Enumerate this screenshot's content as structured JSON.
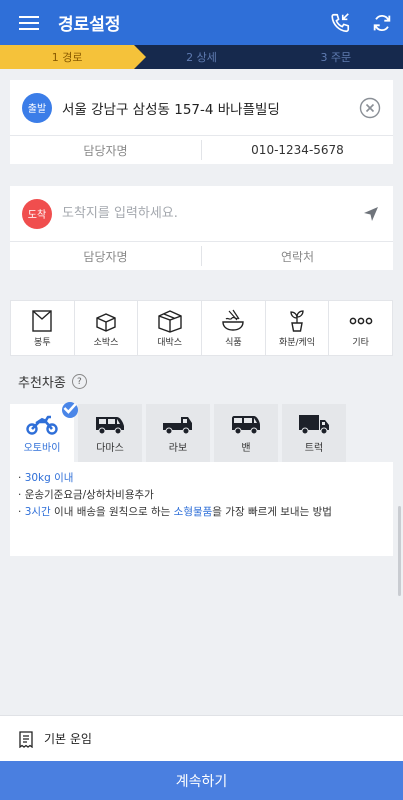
{
  "header": {
    "title": "경로설정"
  },
  "steps": [
    "1 경로",
    "2 상세",
    "3 주문"
  ],
  "departure": {
    "badge": "출발",
    "address": "서울 강남구 삼성동 157-4 바나플빌딩",
    "contact_name_placeholder": "담당자명",
    "contact_phone": "010-1234-5678"
  },
  "arrival": {
    "badge": "도착",
    "address_placeholder": "도착지를 입력하세요.",
    "contact_name_placeholder": "담당자명",
    "contact_phone_placeholder": "연락처"
  },
  "categories": [
    {
      "label": "봉투",
      "icon": "envelope-icon"
    },
    {
      "label": "소박스",
      "icon": "small-box-icon"
    },
    {
      "label": "대박스",
      "icon": "large-box-icon"
    },
    {
      "label": "식품",
      "icon": "food-bowl-icon"
    },
    {
      "label": "화분/케익",
      "icon": "plant-pot-icon"
    },
    {
      "label": "기타",
      "icon": "more-dots-icon"
    }
  ],
  "recommendation": {
    "title": "추천차종",
    "help": "?"
  },
  "vehicles": [
    {
      "label": "오토바이",
      "icon": "motorcycle-icon",
      "selected": true
    },
    {
      "label": "다마스",
      "icon": "minivan-icon",
      "selected": false
    },
    {
      "label": "라보",
      "icon": "pickup-truck-icon",
      "selected": false
    },
    {
      "label": "밴",
      "icon": "van-icon",
      "selected": false
    },
    {
      "label": "트럭",
      "icon": "truck-icon",
      "selected": false
    }
  ],
  "description": {
    "line1": "30kg 이내",
    "line2": "운송기준요금/상하차비용추가",
    "line3_hl1": "3시간",
    "line3_mid": " 이내 배송을 원칙으로 하는 ",
    "line3_hl2": "소형물품",
    "line3_end": "을 가장 빠르게 보내는 방법"
  },
  "fare": {
    "label": "기본 운임"
  },
  "continue_label": "계속하기",
  "colors": {
    "primary": "#2f6fd8",
    "step_active": "#f5c23a",
    "step_bar": "#16294d",
    "departure": "#3b7de8",
    "arrival": "#f04e4e"
  }
}
